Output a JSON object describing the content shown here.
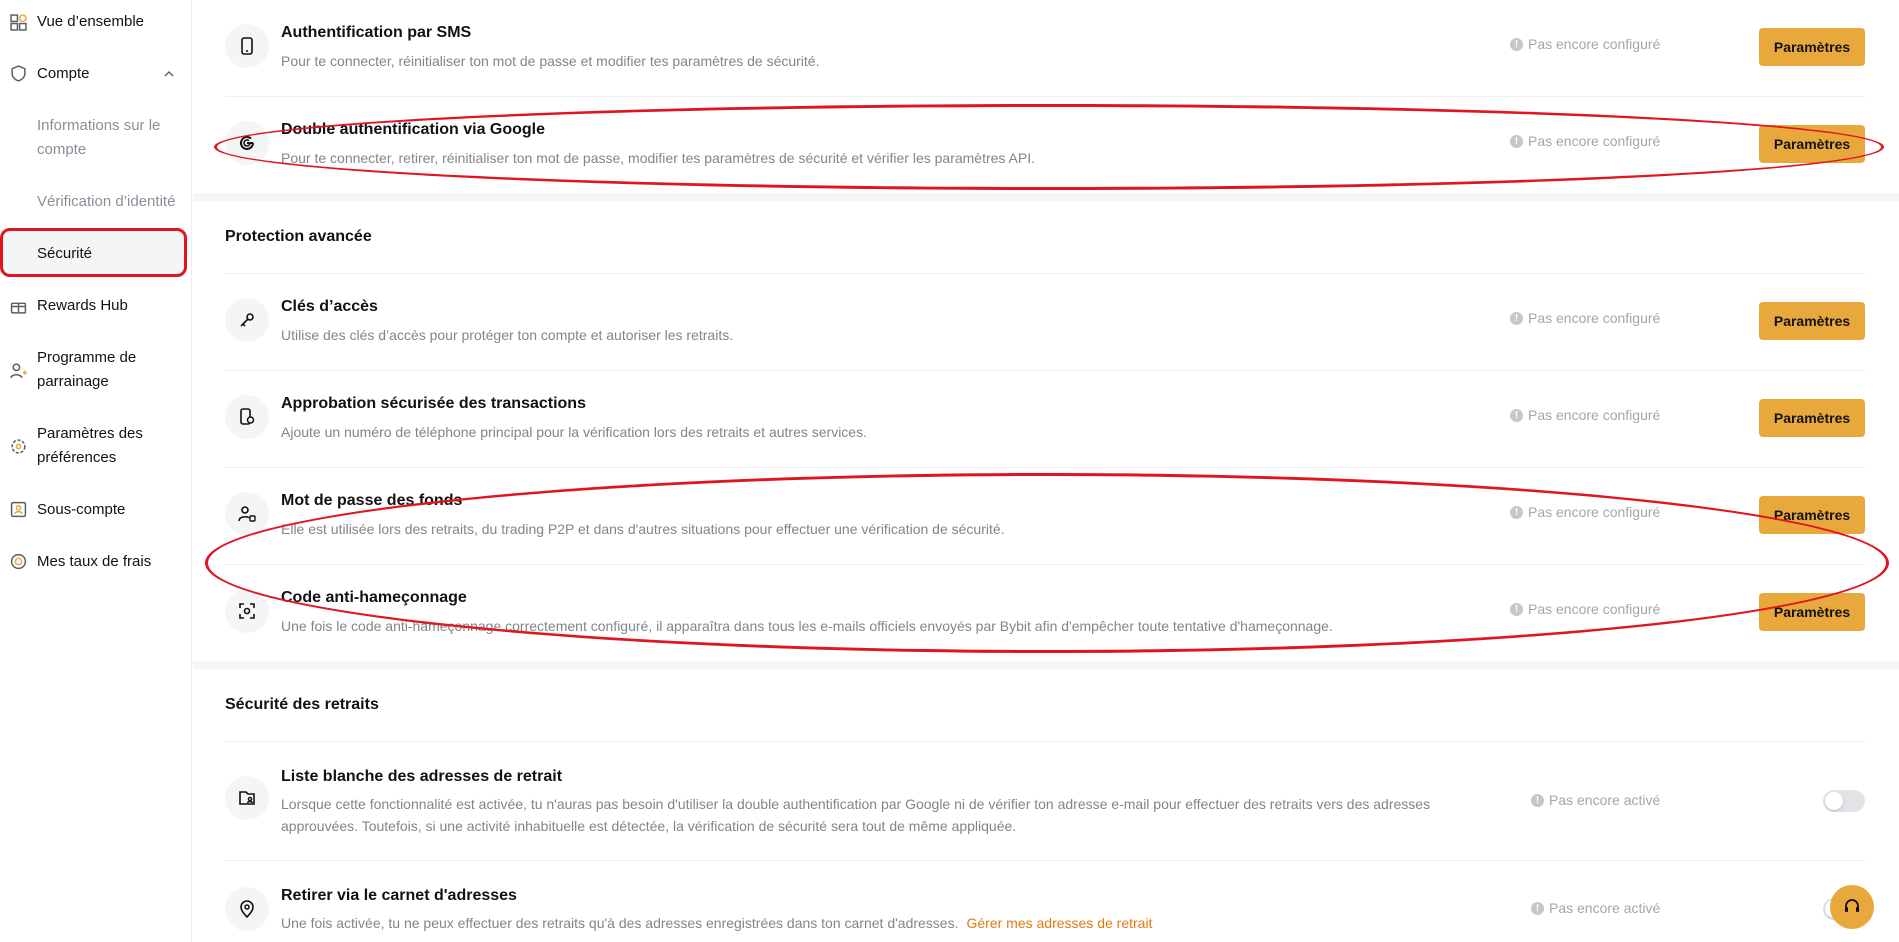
{
  "sidebar": {
    "overview": "Vue d’ensemble",
    "account": "Compte",
    "sub_items": [
      "Informations sur le compte",
      "Vérification d’identité",
      "Sécurité"
    ],
    "rewards": "Rewards Hub",
    "referral": "Programme de parrainage",
    "preferences": "Paramètres des préférences",
    "subaccount": "Sous-compte",
    "fees": "Mes taux de frais"
  },
  "rows": [
    {
      "title": "Authentification par SMS",
      "desc": "Pour te connecter, réinitialiser ton mot de passe et modifier tes paramètres de sécurité.",
      "status": "Pas encore configuré",
      "button": "Paramètres",
      "icon": "phone-icon"
    },
    {
      "title": "Double authentification via Google",
      "desc": "Pour te connecter, retirer, réinitialiser ton mot de passe, modifier tes paramètres de sécurité et vérifier les paramètres API.",
      "status": "Pas encore configuré",
      "button": "Paramètres",
      "icon": "google-icon"
    }
  ],
  "advanced": {
    "title": "Protection avancée",
    "rows": [
      {
        "title": "Clés d’accès",
        "desc": "Utilise des clés d’accès pour protéger ton compte et autoriser les retraits.",
        "status": "Pas encore configuré",
        "button": "Paramètres",
        "icon": "key-icon"
      },
      {
        "title": "Approbation sécurisée des transactions",
        "desc": "Ajoute un numéro de téléphone principal pour la vérification lors des retraits et autres services.",
        "status": "Pas encore configuré",
        "button": "Paramètres",
        "icon": "phone-shield-icon"
      },
      {
        "title": "Mot de passe des fonds",
        "desc": "Elle est utilisée lors des retraits, du trading P2P et dans d'autres situations pour effectuer une vérification de sécurité.",
        "status": "Pas encore configuré",
        "button": "Paramètres",
        "icon": "user-lock-icon"
      },
      {
        "title": "Code anti-hameçonnage",
        "desc": "Une fois le code anti-hameçonnage correctement configuré, il apparaîtra dans tous les e-mails officiels envoyés par Bybit afin d'empêcher toute tentative d'hameçonnage.",
        "status": "Pas encore configuré",
        "button": "Paramètres",
        "icon": "scan-icon"
      }
    ]
  },
  "withdrawal": {
    "title": "Sécurité des retraits",
    "whitelist": {
      "title": "Liste blanche des adresses de retrait",
      "desc_line1": "Lorsque cette fonctionnalité est activée, tu n'auras pas besoin d'utiliser la double authentification par Google ni de vérifier ton adresse e-mail pour effectuer des retraits vers des adresses",
      "desc_line2": "approuvées. Toutefois, si une activité inhabituelle est détectée, la vérification de sécurité sera tout de même appliquée.",
      "status": "Pas encore activé"
    },
    "addressbook": {
      "title": "Retirer via le carnet d'adresses",
      "desc": "Une fois activée, tu ne peux effectuer des retraits qu'à des adresses enregistrées dans ton carnet d'adresses.",
      "link": "Gérer mes adresses de retrait",
      "status": "Pas encore activé"
    }
  },
  "colors": {
    "accent": "#e8a83c",
    "annotation": "#e01520"
  }
}
